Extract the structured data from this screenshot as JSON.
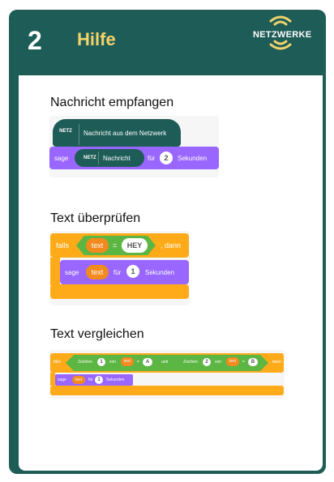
{
  "header": {
    "number": "2",
    "title": "Hilfe",
    "badge": "NETZWERKE"
  },
  "section1": {
    "title": "Nachricht empfangen",
    "hat_netz": "NETZ",
    "hat_text": "Nachricht aus dem Netzwerk",
    "say_label": "sage",
    "say_netz": "NETZ",
    "say_msg": "Nachricht",
    "say_fuer": "für",
    "say_num": "2",
    "say_unit": "Sekunden"
  },
  "section2": {
    "title": "Text überprüfen",
    "if_label": "falls",
    "var_text": "text",
    "eq": "=",
    "literal": "HEY",
    "then": ", dann",
    "say_label": "sage",
    "say_var": "text",
    "say_fuer": "für",
    "say_num": "1",
    "say_unit": "Sekunden"
  },
  "section3": {
    "title": "Text vergleichen",
    "if_label": "falls",
    "zeichen1": "Zeichen",
    "num1": "1",
    "von1": "von",
    "var1": "text",
    "eq1": "=",
    "lit1": "A",
    "und": "und",
    "zeichen2": "Zeichen",
    "num2": "2",
    "von2": "von",
    "var2": "text",
    "eq2": "=",
    "lit2": "B",
    "then": ", dann",
    "say_label": "sage",
    "say_var": "text",
    "say_fuer": "für",
    "say_num": "1",
    "say_unit": "Sekunden"
  },
  "colors": {
    "card": "#1e5c57",
    "title_yellow": "#f2d36b",
    "looks_purple": "#9966ff",
    "control_orange": "#ffab19",
    "operator_green": "#5cb643",
    "var_orange": "#f28a1d"
  }
}
